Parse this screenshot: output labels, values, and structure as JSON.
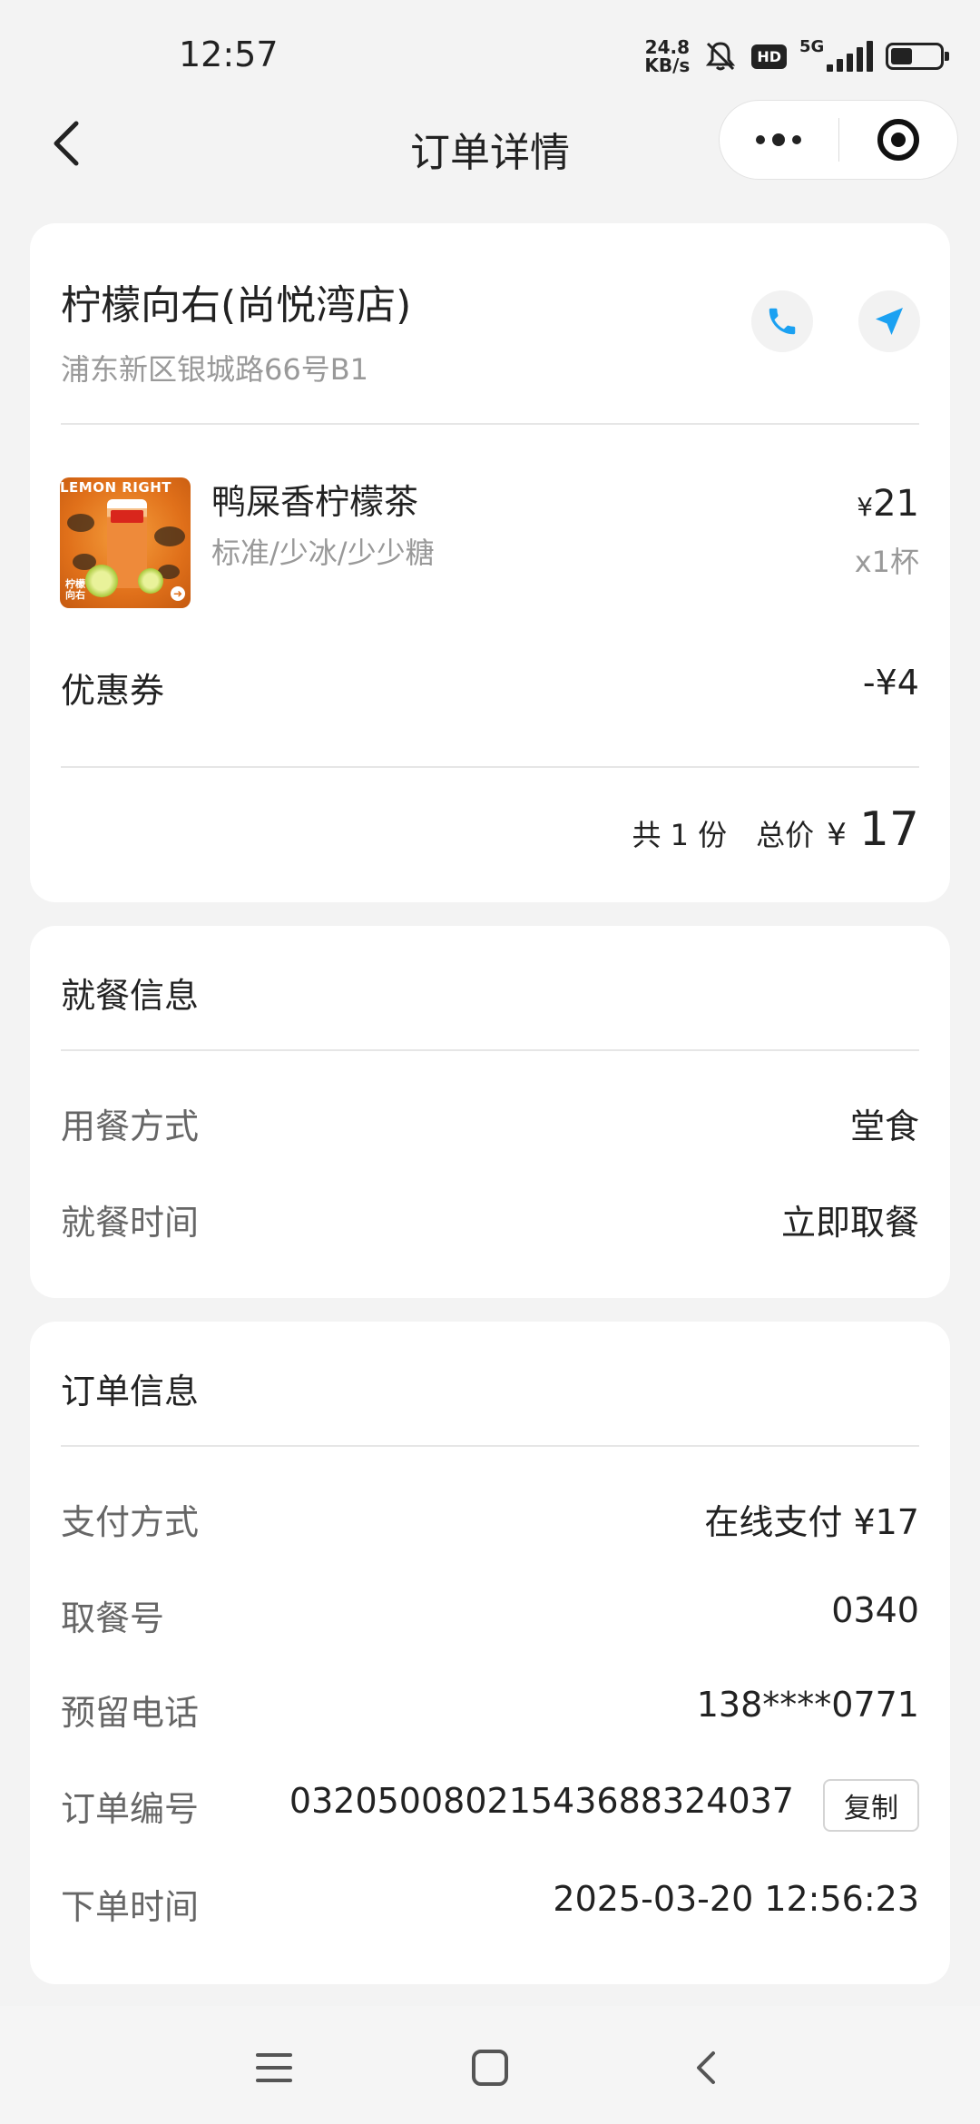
{
  "status_bar": {
    "time": "12:57",
    "net_speed_value": "24.8",
    "net_speed_unit": "KB/s",
    "hd": "HD",
    "network": "5G",
    "battery_level": 0.45
  },
  "header": {
    "title": "订单详情"
  },
  "store": {
    "name": "柠檬向右(尚悦湾店)",
    "address": "浦东新区银城路66号B1"
  },
  "item": {
    "image_brand": "LEMON RIGHT",
    "image_logo_line1": "柠檬",
    "image_logo_line2": "向右",
    "name": "鸭屎香柠檬茶",
    "spec": "标准/少冰/少少糖",
    "currency": "¥",
    "price": "21",
    "quantity": "x1杯"
  },
  "coupon": {
    "label": "优惠券",
    "value": "-¥4"
  },
  "total": {
    "count_text": "共 1 份",
    "label": "总价",
    "currency": "¥",
    "amount": "17"
  },
  "dining": {
    "title": "就餐信息",
    "method_label": "用餐方式",
    "method_value": "堂食",
    "time_label": "就餐时间",
    "time_value": "立即取餐"
  },
  "order": {
    "title": "订单信息",
    "payment_label": "支付方式",
    "payment_value": "在线支付 ¥17",
    "pickup_label": "取餐号",
    "pickup_value": "0340",
    "phone_label": "预留电话",
    "phone_value": "138****0771",
    "number_label": "订单编号",
    "number_value": "03205008021543688324037",
    "copy_label": "复制",
    "time_label": "下单时间",
    "time_value": "2025-03-20 12:56:23"
  },
  "colors": {
    "accent_blue": "#1ba1f2",
    "background": "#f3f3f3"
  },
  "icons": {
    "back": "back-arrow-icon",
    "more": "more-dots-icon",
    "close": "target-close-icon",
    "phone": "phone-icon",
    "navigate": "navigation-arrow-icon"
  }
}
